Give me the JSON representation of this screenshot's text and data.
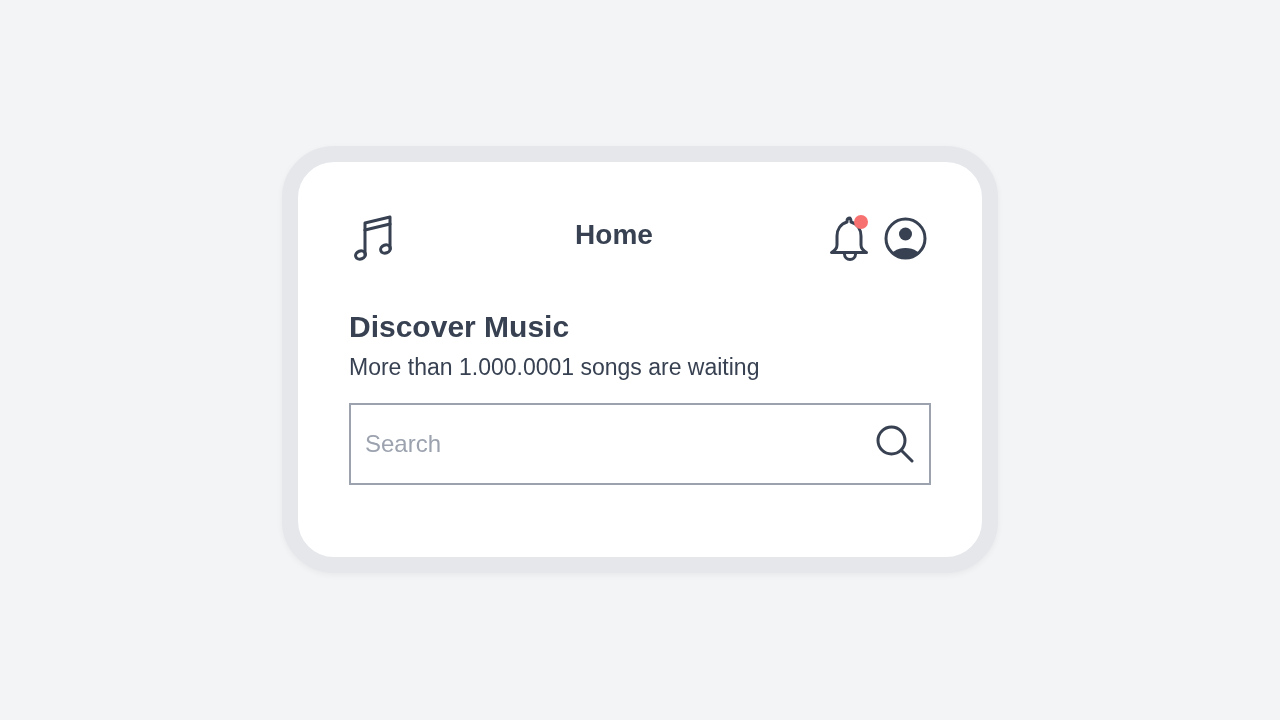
{
  "header": {
    "title": "Home",
    "notifications": {
      "unread": true
    }
  },
  "hero": {
    "title": "Discover Music",
    "subtitle": "More than 1.000.0001 songs are waiting"
  },
  "search": {
    "placeholder": "Search"
  }
}
